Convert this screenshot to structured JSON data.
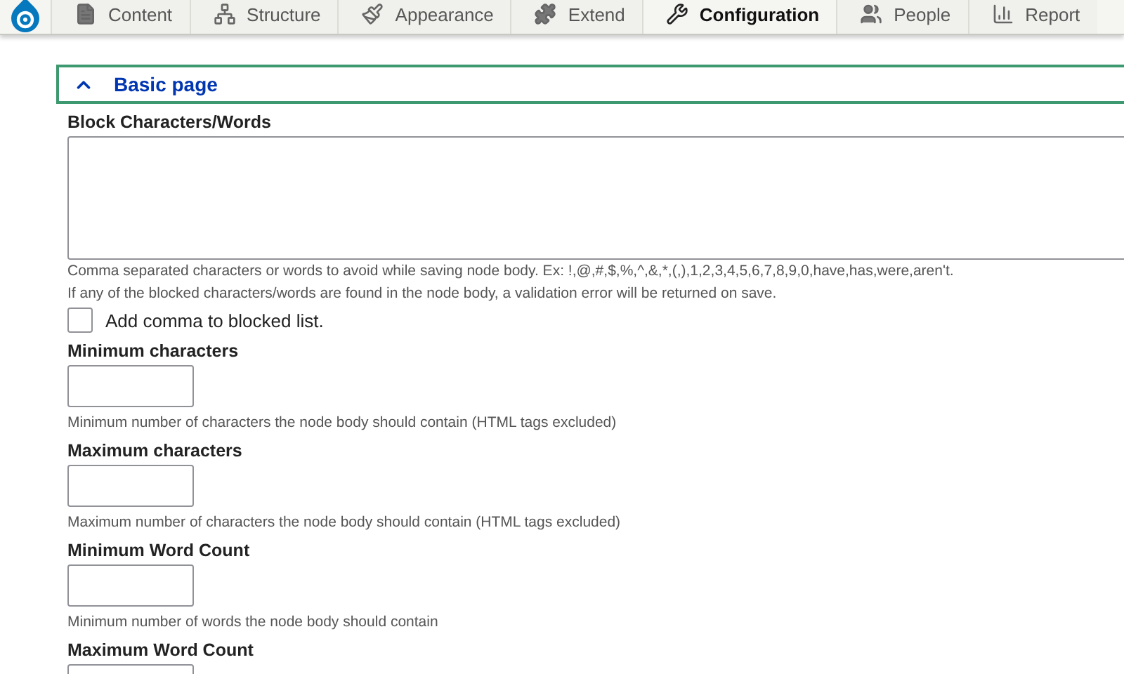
{
  "toolbar": {
    "tabs": [
      {
        "label": "Content",
        "selected": false
      },
      {
        "label": "Structure",
        "selected": false
      },
      {
        "label": "Appearance",
        "selected": false
      },
      {
        "label": "Extend",
        "selected": false
      },
      {
        "label": "Configuration",
        "selected": true
      },
      {
        "label": "People",
        "selected": false
      },
      {
        "label": "Report",
        "selected": false
      }
    ]
  },
  "section": {
    "title": "Basic page",
    "expanded": true
  },
  "blocked": {
    "label": "Block Characters/Words",
    "descriptions": [
      "Comma separated characters or words to avoid while saving node body. Ex: !,@,#,$,%,^,&,*,(,),1,2,3,4,5,6,7,8,9,0,have,has,were,aren't.",
      "If any of the blocked characters/words are found in the node body, a validation error will be returned on save."
    ]
  },
  "comma_checkbox": {
    "label": "Add comma to blocked list.",
    "checked": false
  },
  "fields": [
    {
      "label": "Minimum characters",
      "description": "Minimum number of characters the node body should contain (HTML tags excluded)"
    },
    {
      "label": "Maximum characters",
      "description": "Maximum number of characters the node body should contain (HTML tags excluded)"
    },
    {
      "label": "Minimum Word Count",
      "description": "Minimum number of words the node body should contain"
    },
    {
      "label": "Maximum Word Count"
    }
  ]
}
